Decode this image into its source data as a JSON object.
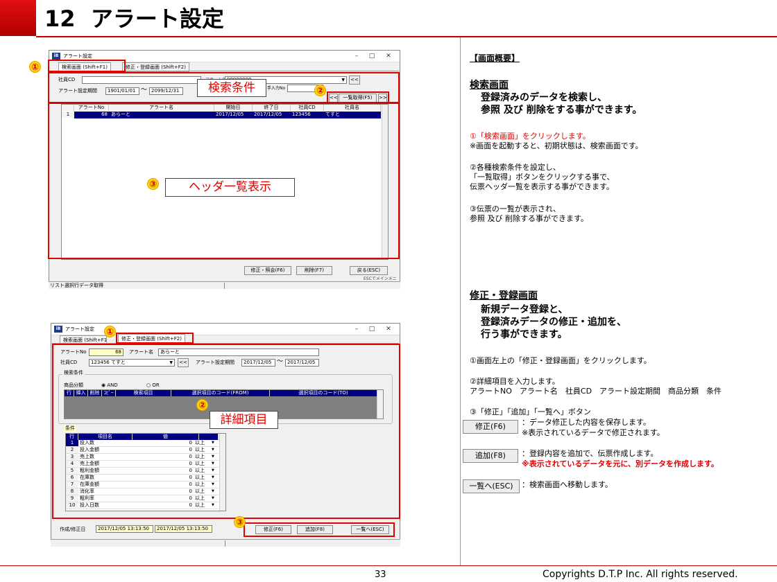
{
  "page": {
    "section_number": "12",
    "title": "アラート設定",
    "page_number": "33",
    "copyright": "Copyrights  D.T.P Inc. All rights reserved.",
    "colors": {
      "accent_red": "#c00000",
      "mark_yellow": "#ffd700",
      "grid_selection": "#000080"
    }
  },
  "window1": {
    "title": "アラート設定",
    "tabs": [
      "検索画面 (Shift+F1)",
      "修正・登録画面 (Shift+F2)"
    ],
    "labels": {
      "employee_cd": "社員CD",
      "period": "アラート設定期間",
      "tilde": "～",
      "alert_name": "アラート名",
      "entry_no": "手入力No"
    },
    "values": {
      "period_from": "1901/01/01",
      "period_to": "2099/12/31",
      "alert_name_value": "99999999"
    },
    "buttons": {
      "back_nav": "<<",
      "fetch_list": "一覧取得(F5)",
      "prev": "<<",
      "next": ">>",
      "edit": "修正・照会(F6)",
      "delete": "削除(F7)",
      "back": "戻る(ESC)"
    },
    "grid": {
      "headers": [
        "アラートNo",
        "アラート名",
        "開始日",
        "終了日",
        "社員CD",
        "社員名"
      ],
      "rows": [
        {
          "rownum": "1",
          "no": "68",
          "name": "あらーと",
          "start": "2017/12/05",
          "end": "2017/12/05",
          "emp_cd": "123456",
          "emp_name": "てすと"
        }
      ]
    },
    "esc_note": "ESCでメインメニ",
    "status": "リスト選択行データ取得"
  },
  "window2": {
    "title": "アラート設定",
    "tabs": [
      "検索画面 (Shift+F1)",
      "修正・登録画面 (Shift+F2)"
    ],
    "labels": {
      "alert_no": "アラートNo",
      "alert_name": "アラート名",
      "employee_cd": "社員CD",
      "period": "アラート設定期間",
      "tilde": "～",
      "search_cond": "検索条件",
      "product_class": "商品分類",
      "and": "AND",
      "or": "OR",
      "conditions": "条件",
      "created_updated": "作成/修正日"
    },
    "values": {
      "alert_no": "68",
      "alert_name": "あらーと",
      "employee": "123456 てすと",
      "period_from": "2017/12/05",
      "period_to": "2017/12/05",
      "created": "2017/12/05 13:13:50",
      "updated": "2017/12/05 13:13:50"
    },
    "detail_headers": [
      "行",
      "挿入",
      "削除",
      "ｺﾋﾟｰ",
      "検索項目",
      "選択項目のコード(FROM)",
      "選択項目のコード(TO)"
    ],
    "cond_headers": [
      "行",
      "項目名",
      "値"
    ],
    "cond_rows": [
      {
        "no": "1",
        "name": "投入数",
        "value": "0",
        "op": "以上"
      },
      {
        "no": "2",
        "name": "投入金額",
        "value": "0",
        "op": "以上"
      },
      {
        "no": "3",
        "name": "売上数",
        "value": "0",
        "op": "以上"
      },
      {
        "no": "4",
        "name": "売上金額",
        "value": "0",
        "op": "以上"
      },
      {
        "no": "5",
        "name": "粗利金額",
        "value": "0",
        "op": "以上"
      },
      {
        "no": "6",
        "name": "在庫数",
        "value": "0",
        "op": "以上"
      },
      {
        "no": "7",
        "name": "在庫金額",
        "value": "0",
        "op": "以上"
      },
      {
        "no": "8",
        "name": "消化率",
        "value": "0",
        "op": "以上"
      },
      {
        "no": "9",
        "name": "粗利率",
        "value": "0",
        "op": "以上"
      },
      {
        "no": "10",
        "name": "投入日数",
        "value": "0",
        "op": "以上"
      }
    ],
    "buttons": {
      "back_nav": "<<",
      "edit": "修正(F6)",
      "add": "追加(F8)",
      "to_list": "一覧へ(ESC)"
    }
  },
  "annotations": {
    "mark1": "①",
    "mark2": "②",
    "mark3": "③",
    "search_conditions": "検索条件",
    "header_list": "ヘッダ一覧表示",
    "detail_items": "詳細項目"
  },
  "right": {
    "overview": "【画面概要】",
    "search_title": "検索画面",
    "search_desc1": "登録済みのデータを検索し、",
    "search_desc2": "参照 及び 削除をする事ができます。",
    "s1a": "①「検索画面」をクリックします。",
    "s1b": "※画面を起動すると、初期状態は、検索画面です。",
    "s2a": "②各種検索条件を設定し、",
    "s2b": "「一覧取得」ボタンをクリックする事で、",
    "s2c": "伝票ヘッダ一覧を表示する事ができます。",
    "s3a": "③伝票の一覧が表示され、",
    "s3b": "参照 及び 削除する事ができます。",
    "edit_title": "修正・登録画面",
    "edit_desc1": "新規データ登録と、",
    "edit_desc2": "登録済みデータの修正・追加を、",
    "edit_desc3": "行う事ができます。",
    "e1": "①画面左上の「修正・登録画面」をクリックします。",
    "e2a": "②詳細項目を入力します。",
    "e2b": "アラートNO　アラート名　社員CD　アラート設定期間　商品分類　条件",
    "e3": "③「修正」「追加」「一覧へ」ボタン",
    "btn_edit": "修正(F6)",
    "btn_edit_desc1": "：データ修正した内容を保存します。",
    "btn_edit_desc2": "※表示されているデータで修正されます。",
    "btn_add": "追加(F8)",
    "btn_add_desc1": "：登録内容を追加で、伝票作成します。",
    "btn_add_desc2": "※表示されているデータを元に、別データを作成します。",
    "btn_list": "一覧へ(ESC)",
    "btn_list_desc": "：検索画面へ移動します。"
  }
}
